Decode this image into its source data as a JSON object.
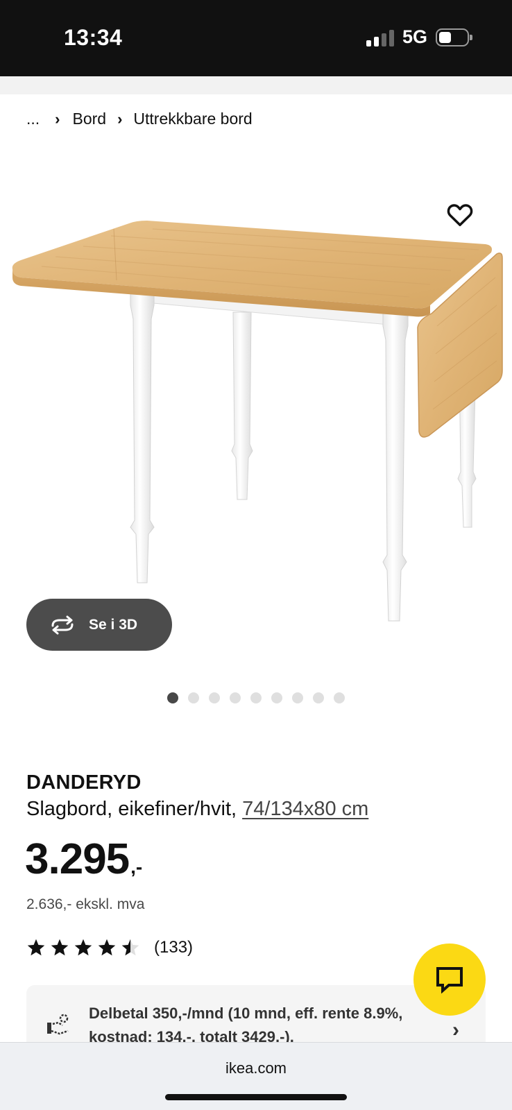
{
  "status_bar": {
    "time": "13:34",
    "network": "5G"
  },
  "breadcrumb": {
    "ellipsis": "...",
    "items": [
      "Bord",
      "Uttrekkbare bord"
    ]
  },
  "gallery": {
    "view_3d_label": "Se i 3D",
    "dot_count": 9,
    "active_index": 0
  },
  "product": {
    "name": "DANDERYD",
    "description": "Slagbord, eikefiner/hvit, ",
    "size_link": "74/134x80 cm",
    "price": "3.295",
    "price_suffix": ",-",
    "price_ex_vat": "2.636,- ekskl. mva",
    "rating": 4.5,
    "review_count": "(133)"
  },
  "financing": {
    "text": "Delbetal 350,-/mnd (10 mnd, eff. rente 8.9%, kostnad: 134,-, totalt 3429,-)."
  },
  "browser": {
    "url": "ikea.com"
  },
  "colors": {
    "ikea_yellow": "#fbd914",
    "wood": "#e2b77a",
    "button_dark": "#4c4c4c"
  }
}
